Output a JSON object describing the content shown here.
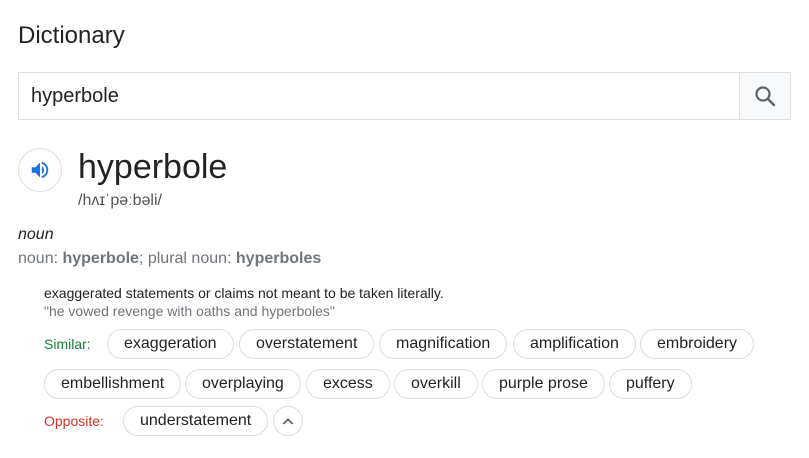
{
  "header": {
    "title": "Dictionary"
  },
  "search": {
    "value": "hyperbole",
    "icon": "search-icon"
  },
  "entry": {
    "word": "hyperbole",
    "phonetic": "/hʌɪˈpəːbəli/",
    "part_of_speech": "noun",
    "forms": {
      "prefix": "noun: ",
      "noun": "hyperbole",
      "plural_prefix": "; plural noun: ",
      "plural": "hyperboles"
    },
    "definition": "exaggerated statements or claims not meant to be taken literally.",
    "example": "\"he vowed revenge with oaths and hyperboles\"",
    "similar_label": "Similar:",
    "similar": [
      "exaggeration",
      "overstatement",
      "magnification",
      "amplification",
      "embroidery",
      "embellishment",
      "overplaying",
      "excess",
      "overkill",
      "purple prose",
      "puffery"
    ],
    "opposite_label": "Opposite:",
    "opposite": [
      "understatement"
    ]
  },
  "colors": {
    "similar_label": "#188038",
    "opposite_label": "#d93025",
    "speaker": "#1a73e8"
  }
}
